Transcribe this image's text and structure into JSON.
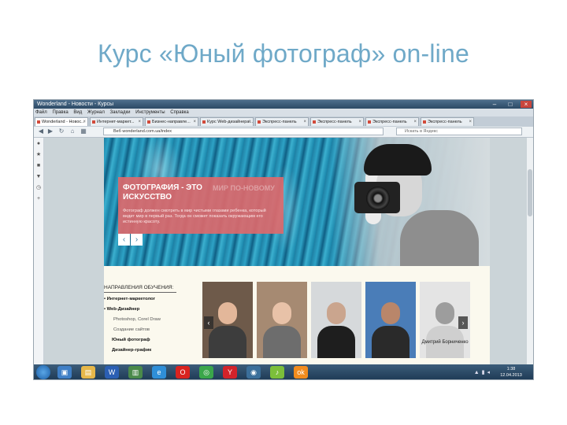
{
  "slide": {
    "title": "Курс «Юный фотограф» on-line"
  },
  "window": {
    "title": "Wonderland - Новости - Курсы",
    "menu": [
      "Файл",
      "Правка",
      "Вид",
      "Журнал",
      "Закладки",
      "Инструменты",
      "Справка"
    ]
  },
  "tabs": [
    {
      "label": "Wonderland - Новос..."
    },
    {
      "label": "Интернет-маркет..."
    },
    {
      "label": "Бизнес-направле..."
    },
    {
      "label": "Курс Web-дизайнера..."
    },
    {
      "label": "Экспресс-панель"
    },
    {
      "label": "Экспресс-панель"
    },
    {
      "label": "Экспресс-панель"
    },
    {
      "label": "Экспресс-панель"
    },
    {
      "label": "Экспресс-панель"
    }
  ],
  "nav": {
    "url": "Веб   wonderland.com.ua/index",
    "search_placeholder": "Искать в Яндекс"
  },
  "hero": {
    "heading_line1": "ФОТОГРАФИЯ - ЭТО",
    "heading_line2": "ИСКУССТВО",
    "ghost_text": "МИР ПО-НОВОМУ",
    "text": "Фотограф должен смотреть в мир чистыми глазами ребенка, который видит мир в первый раз. Тогда он сможет показать окружающим его истинную красоту.",
    "prev": "‹",
    "next": "›"
  },
  "directions": {
    "title": "НАПРАВЛЕНИЯ ОБУЧЕНИЯ:",
    "items": [
      {
        "label": "• Интернет-маркетолог"
      },
      {
        "label": "• Web-Дизайнер"
      },
      {
        "label": "Photoshop, Corel Draw"
      },
      {
        "label": "Создание сайтов"
      },
      {
        "label": "Юный фотограф"
      },
      {
        "label": "Дизайнер-график"
      }
    ]
  },
  "teachers": {
    "last_caption": "Дмитрий Борниченко",
    "prev": "‹",
    "next": "›"
  },
  "taskbar": {
    "time": "1:38",
    "date": "12.04.2013",
    "word_icon": "W",
    "opera_icon": "O"
  },
  "colors": {
    "title": "#6fa9c8",
    "banner": "#e0686a",
    "hero": "#1f7fa3"
  }
}
